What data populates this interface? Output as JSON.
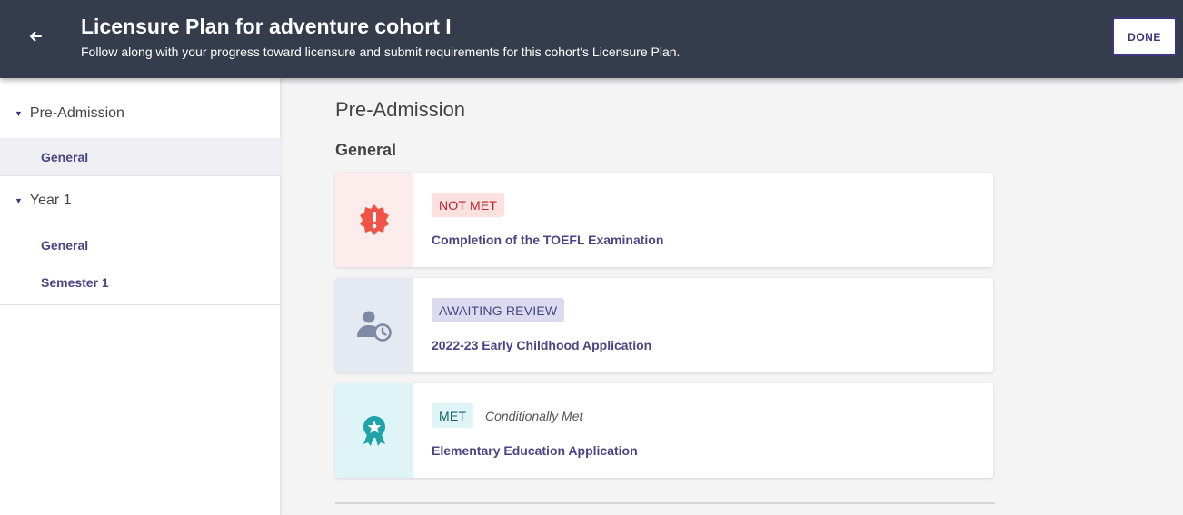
{
  "header": {
    "title": "Licensure Plan for adventure cohort I",
    "subtitle": "Follow along with your progress toward licensure and submit requirements for this cohort's Licensure Plan.",
    "back_icon": "arrow-left-icon",
    "done_label": "DONE",
    "background": "#353c4b"
  },
  "sidebar": {
    "groups": [
      {
        "label": "Pre-Admission",
        "caret_icon": "caret-down-icon",
        "items": [
          {
            "label": "General",
            "active": true
          }
        ]
      },
      {
        "label": "Year 1",
        "caret_icon": "caret-down-icon",
        "items": [
          {
            "label": "General",
            "active": false
          },
          {
            "label": "Semester 1",
            "active": false
          }
        ]
      }
    ]
  },
  "main": {
    "title": "Pre-Admission",
    "section_title": "General",
    "cards": [
      {
        "icon": "alert-badge-icon",
        "badge": "NOT MET",
        "badge_sub": "",
        "title": "Completion of the TOEFL Examination",
        "colors": {
          "icon_bg": "#fdecec",
          "icon": "#f05446",
          "badge_bg": "#fde1e1",
          "badge_text": "#b8282f"
        }
      },
      {
        "icon": "user-clock-icon",
        "badge": "AWAITING REVIEW",
        "badge_sub": "",
        "title": "2022-23 Early Childhood Application",
        "colors": {
          "icon_bg": "#e4e9f2",
          "icon": "#7e8aa5",
          "badge_bg": "#dcdaee",
          "badge_text": "#4a4584"
        }
      },
      {
        "icon": "award-ribbon-icon",
        "badge": "MET",
        "badge_sub": "Conditionally Met",
        "title": "Elementary Education Application",
        "colors": {
          "icon_bg": "#dff4f6",
          "icon": "#1fa3a8",
          "badge_bg": "#dff4f6",
          "badge_text": "#14606a"
        }
      }
    ]
  }
}
